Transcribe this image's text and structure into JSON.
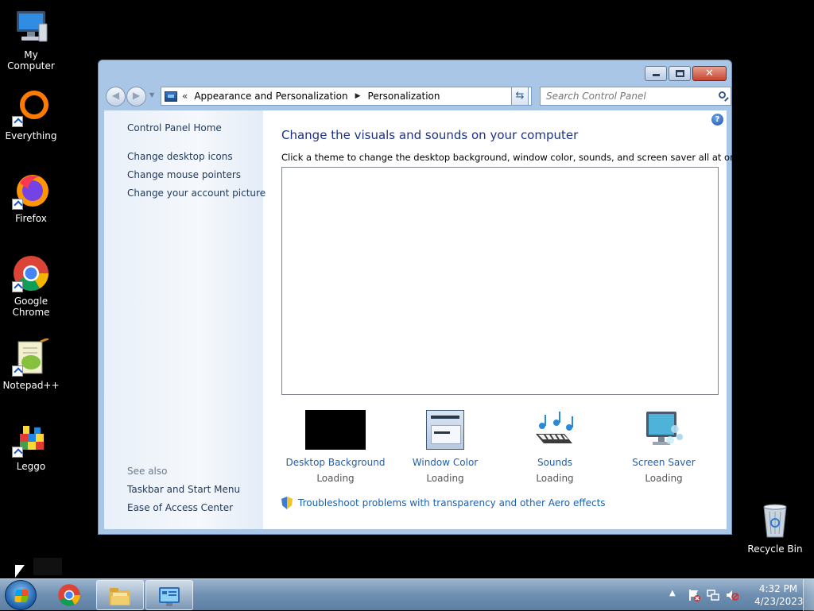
{
  "desktop": {
    "icons": [
      {
        "label": "My Computer",
        "icon": "computer-icon"
      },
      {
        "label": "Everything",
        "icon": "everything-icon"
      },
      {
        "label": "Firefox",
        "icon": "firefox-icon"
      },
      {
        "label": "Google Chrome",
        "icon": "chrome-icon"
      },
      {
        "label": "Notepad++",
        "icon": "notepadpp-icon"
      },
      {
        "label": "Leggo",
        "icon": "leggo-icon"
      },
      {
        "label": "Recycle Bin",
        "icon": "recycle-bin-icon"
      }
    ]
  },
  "window": {
    "breadcrumb": {
      "overflow": "«",
      "items": [
        "Appearance and Personalization",
        "Personalization"
      ]
    },
    "search_placeholder": "Search Control Panel",
    "sidebar": {
      "home": "Control Panel Home",
      "links": [
        "Change desktop icons",
        "Change mouse pointers",
        "Change your account picture"
      ],
      "see_also_heading": "See also",
      "see_also": [
        "Taskbar and Start Menu",
        "Ease of Access Center"
      ]
    },
    "main": {
      "title": "Change the visuals and sounds on your computer",
      "subtitle": "Click a theme to change the desktop background, window color, sounds, and screen saver all at once.",
      "tiles": [
        {
          "name": "Desktop Background",
          "status": "Loading",
          "icon": "desktop-background-icon"
        },
        {
          "name": "Window Color",
          "status": "Loading",
          "icon": "window-color-icon"
        },
        {
          "name": "Sounds",
          "status": "Loading",
          "icon": "sounds-icon"
        },
        {
          "name": "Screen Saver",
          "status": "Loading",
          "icon": "screen-saver-icon"
        }
      ],
      "troubleshoot": "Troubleshoot problems with transparency and other Aero effects"
    },
    "help_glyph": "?"
  },
  "taskbar": {
    "pinned": [
      "chrome-icon",
      "file-explorer-icon",
      "control-panel-icon"
    ],
    "clock": {
      "time": "4:32 PM",
      "date": "4/23/2023"
    }
  },
  "colors": {
    "link": "#1d5fae",
    "title": "#1e3287",
    "taskbar": "#6e8fb1"
  }
}
